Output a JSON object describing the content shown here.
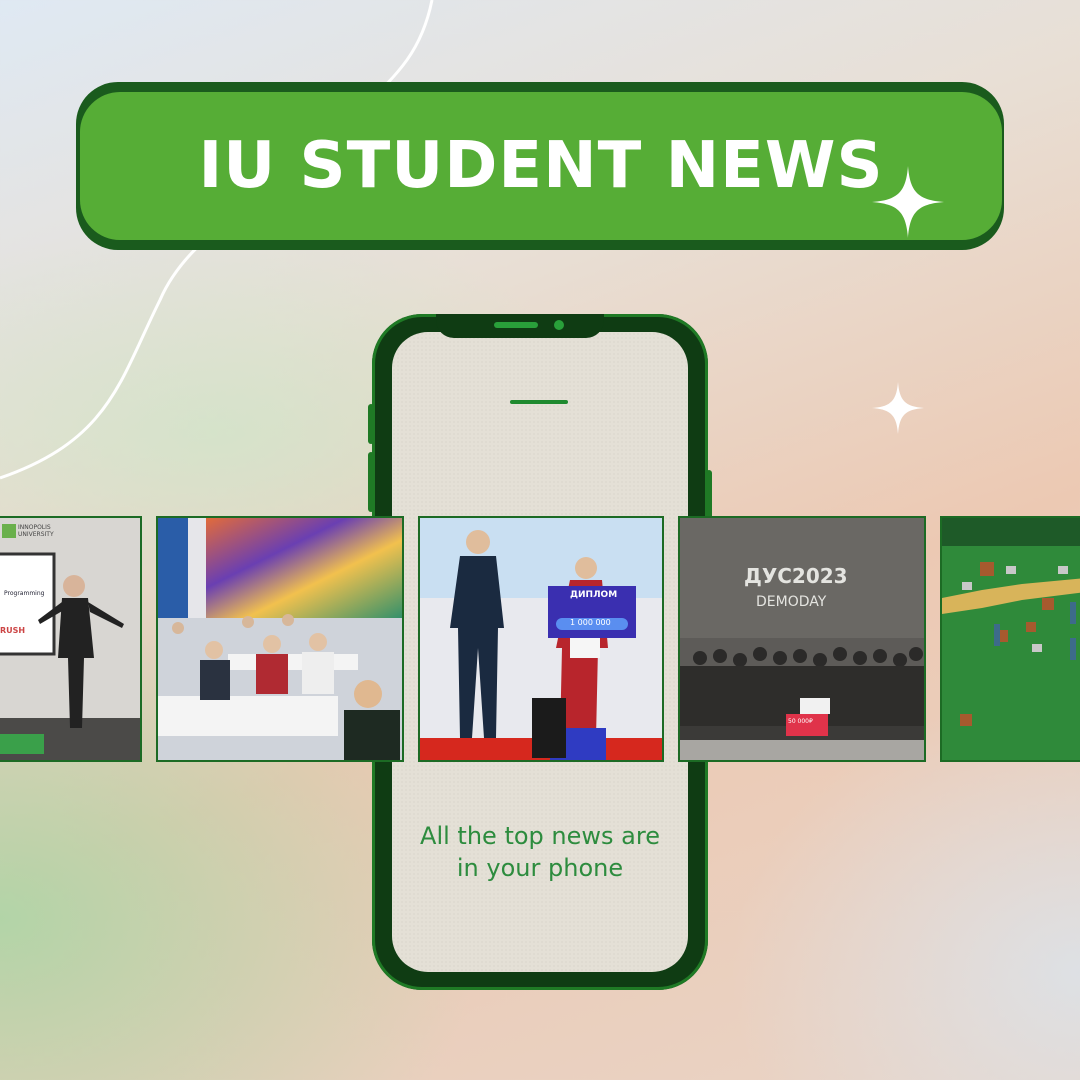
{
  "banner": {
    "title": "IU STUDENT NEWS"
  },
  "phone": {
    "caption_line1": "All the top news are",
    "caption_line2": "in your phone"
  },
  "cards": {
    "card1": {
      "logo_line1": "INNOPOLIS",
      "logo_line2": "UNIVERSITY",
      "slide_text": "Programming",
      "slide_text2": "RUSH"
    },
    "card3": {
      "banner_title": "ДИПЛОМ",
      "banner_amount": "1 000 000"
    },
    "card4": {
      "title": "ДУС2023",
      "subtitle": "DEMODAY",
      "check_amount": "50 000₽"
    }
  },
  "colors": {
    "brand_green": "#56ad36",
    "dark_green": "#1a5b1d",
    "text_green": "#2d8c3e"
  }
}
